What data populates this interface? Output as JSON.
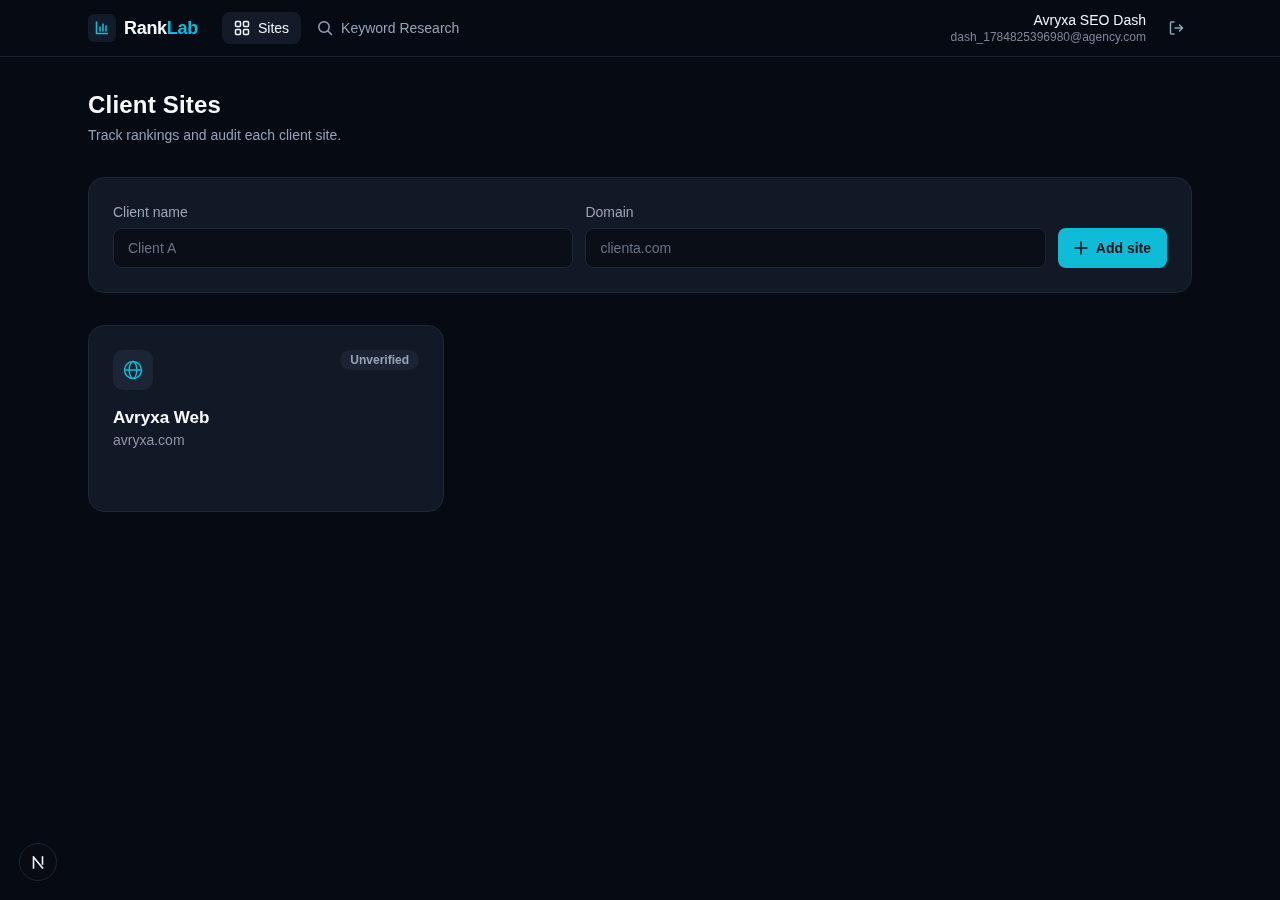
{
  "brand": {
    "parts": [
      "Rank",
      "Lab"
    ]
  },
  "nav": {
    "items": [
      {
        "label": "Sites",
        "selected": true
      },
      {
        "label": "Keyword Research",
        "selected": false
      }
    ]
  },
  "user": {
    "name": "Avryxa SEO Dash",
    "email": "dash_1784825396980@agency.com"
  },
  "page": {
    "title": "Client Sites",
    "subtitle": "Track rankings and audit each client site."
  },
  "add_form": {
    "fields": [
      {
        "label": "Client name",
        "placeholder": "Client A"
      },
      {
        "label": "Domain",
        "placeholder": "clienta.com"
      }
    ],
    "button": "Add site"
  },
  "sites": [
    {
      "name": "Avryxa Web",
      "domain": "avryxa.com",
      "badge": "Unverified",
      "verified": false
    }
  ]
}
